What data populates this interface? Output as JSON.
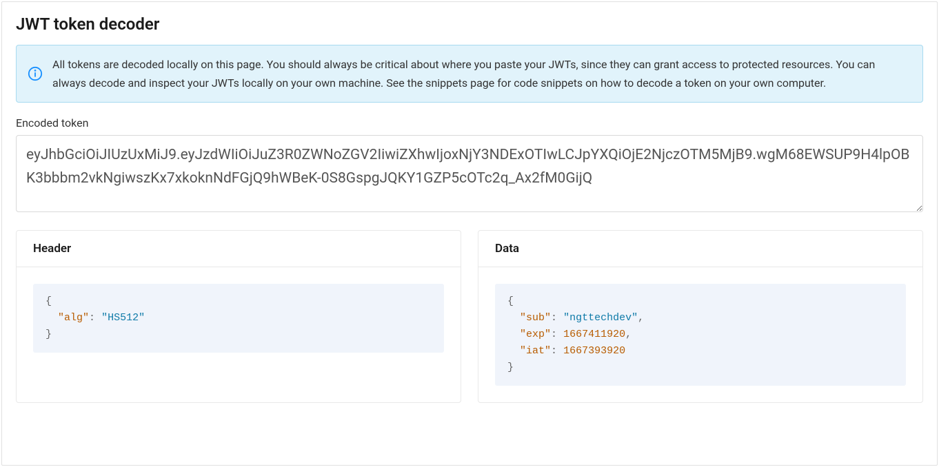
{
  "page": {
    "title": "JWT token decoder"
  },
  "info": {
    "text": "All tokens are decoded locally on this page. You should always be critical about where you paste your JWTs, since they can grant access to protected resources. You can always decode and inspect your JWTs locally on your own machine. See the snippets page for code snippets on how to decode a token on your own computer."
  },
  "encoded": {
    "label": "Encoded token",
    "value": "eyJhbGciOiJIUzUxMiJ9.eyJzdWIiOiJuZ3R0ZWNoZGV2IiwiZXhwIjoxNjY3NDExOTIwLCJpYXQiOjE2NjczOTM5MjB9.wgM68EWSUP9H4lpOBK3bbbm2vkNgiwszKx7xkoknNdFGjQ9hWBeK-0S8GspgJQKY1GZP5cOTc2q_Ax2fM0GijQ"
  },
  "header_card": {
    "title": "Header",
    "json": {
      "alg": "HS512"
    }
  },
  "data_card": {
    "title": "Data",
    "json": {
      "sub": "ngttechdev",
      "exp": 1667411920,
      "iat": 1667393920
    }
  }
}
